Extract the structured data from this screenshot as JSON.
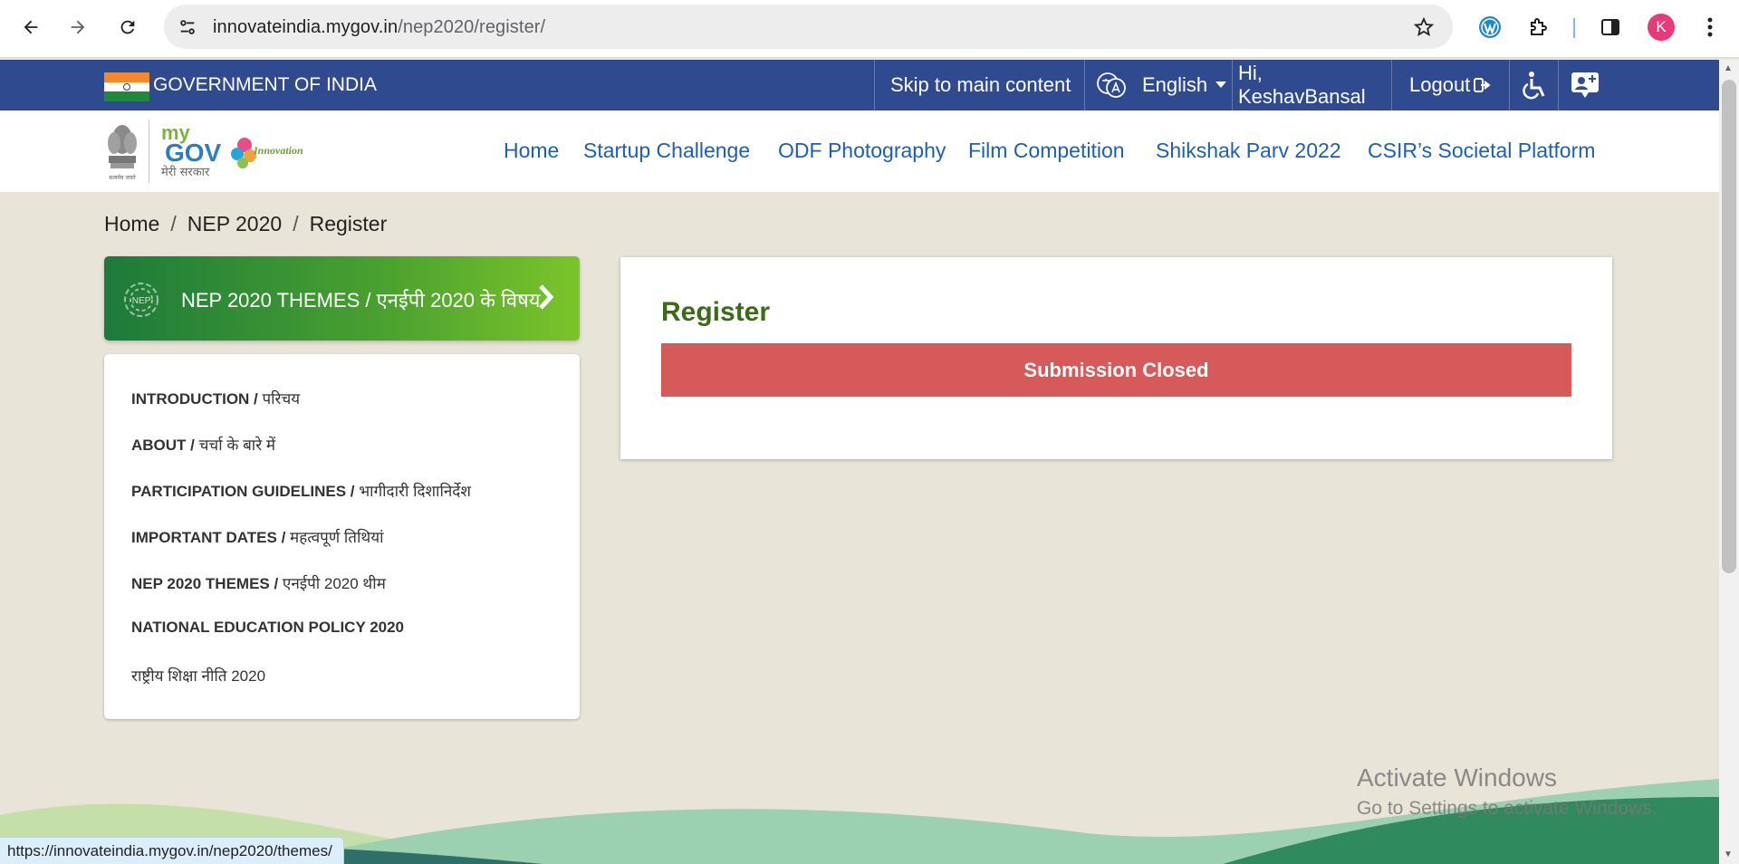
{
  "browser": {
    "url_host": "innovateindia.mygov.in",
    "url_path": "/nep2020/register/",
    "profile_initial": "K",
    "status_url": "https://innovateindia.mygov.in/nep2020/themes/"
  },
  "govbar": {
    "title": "GOVERNMENT OF INDIA",
    "skip": "Skip to main content",
    "language": "English",
    "greeting": "Hi, KeshavBansal",
    "logout": "Logout"
  },
  "logo": {
    "my": "my",
    "gov": "GOV",
    "hindi": "मेरी सरकार",
    "innovation": "Innovation",
    "emblem_text": "सत्यमेव जयते"
  },
  "menu": [
    "Home",
    "Startup Challenge",
    "ODF Photography",
    "Film Competition",
    "Shikshak Parv 2022",
    "CSIR’s Societal Platform"
  ],
  "breadcrumb": [
    "Home",
    "NEP 2020",
    "Register"
  ],
  "themes_button": {
    "label": "NEP 2020 THEMES / एनईपी 2020 के विषय",
    "badge": "NEP"
  },
  "side_menu": [
    {
      "en": "INTRODUCTION / ",
      "hi": "परिचय"
    },
    {
      "en": "ABOUT / ",
      "hi": "चर्चा के बारे में"
    },
    {
      "en": "PARTICIPATION GUIDELINES / ",
      "hi": "भागीदारी दिशानिर्देश"
    },
    {
      "en": "IMPORTANT DATES / ",
      "hi": "महत्वपूर्ण तिथियां"
    },
    {
      "en": "NEP 2020 THEMES / ",
      "hi": "एनईपी 2020 थीम"
    },
    {
      "en": "NATIONAL EDUCATION POLICY 2020",
      "hi": ""
    },
    {
      "en": "",
      "hi": "राष्ट्रीय शिक्षा नीति 2020"
    }
  ],
  "register": {
    "title": "Register",
    "status": "Submission Closed"
  },
  "watermark": {
    "line1": "Activate Windows",
    "line2": "Go to Settings to activate Windows."
  },
  "colors": {
    "govbar": "#2f4a8f",
    "menu_link": "#1f5fb0",
    "register_title": "#3b6b16",
    "submission_closed": "#d65a5a",
    "page_bg": "#e8e5d8"
  }
}
